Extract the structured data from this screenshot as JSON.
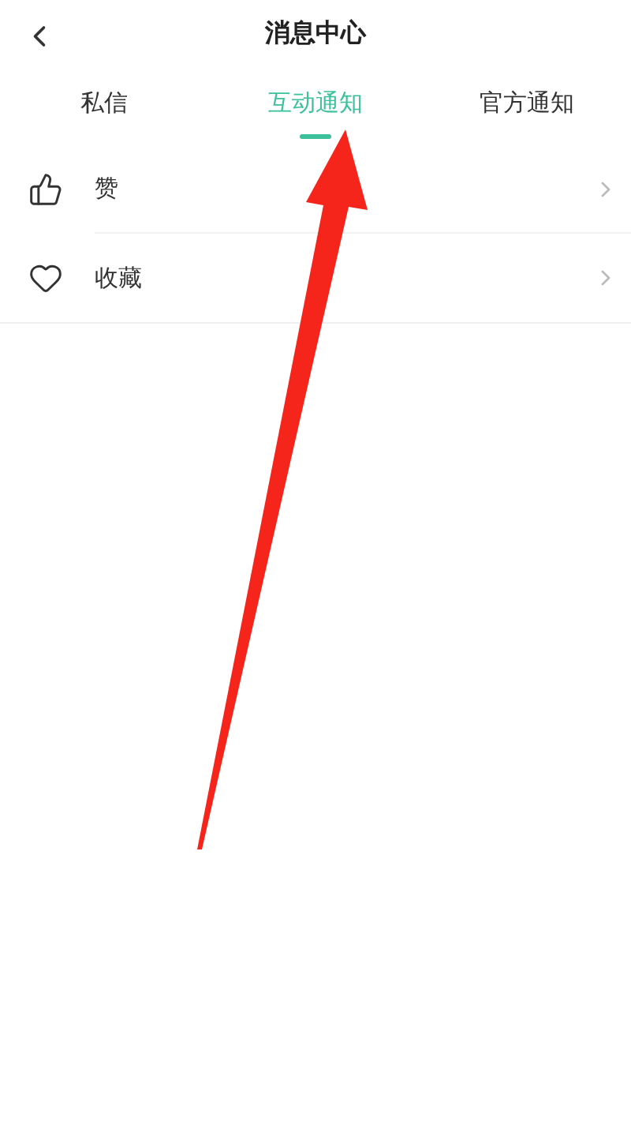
{
  "header": {
    "title": "消息中心"
  },
  "tabs": [
    {
      "label": "私信",
      "selected": false
    },
    {
      "label": "互动通知",
      "selected": true
    },
    {
      "label": "官方通知",
      "selected": false
    }
  ],
  "items": [
    {
      "kind": "like",
      "label": "赞"
    },
    {
      "kind": "favorite",
      "label": "收藏"
    }
  ]
}
